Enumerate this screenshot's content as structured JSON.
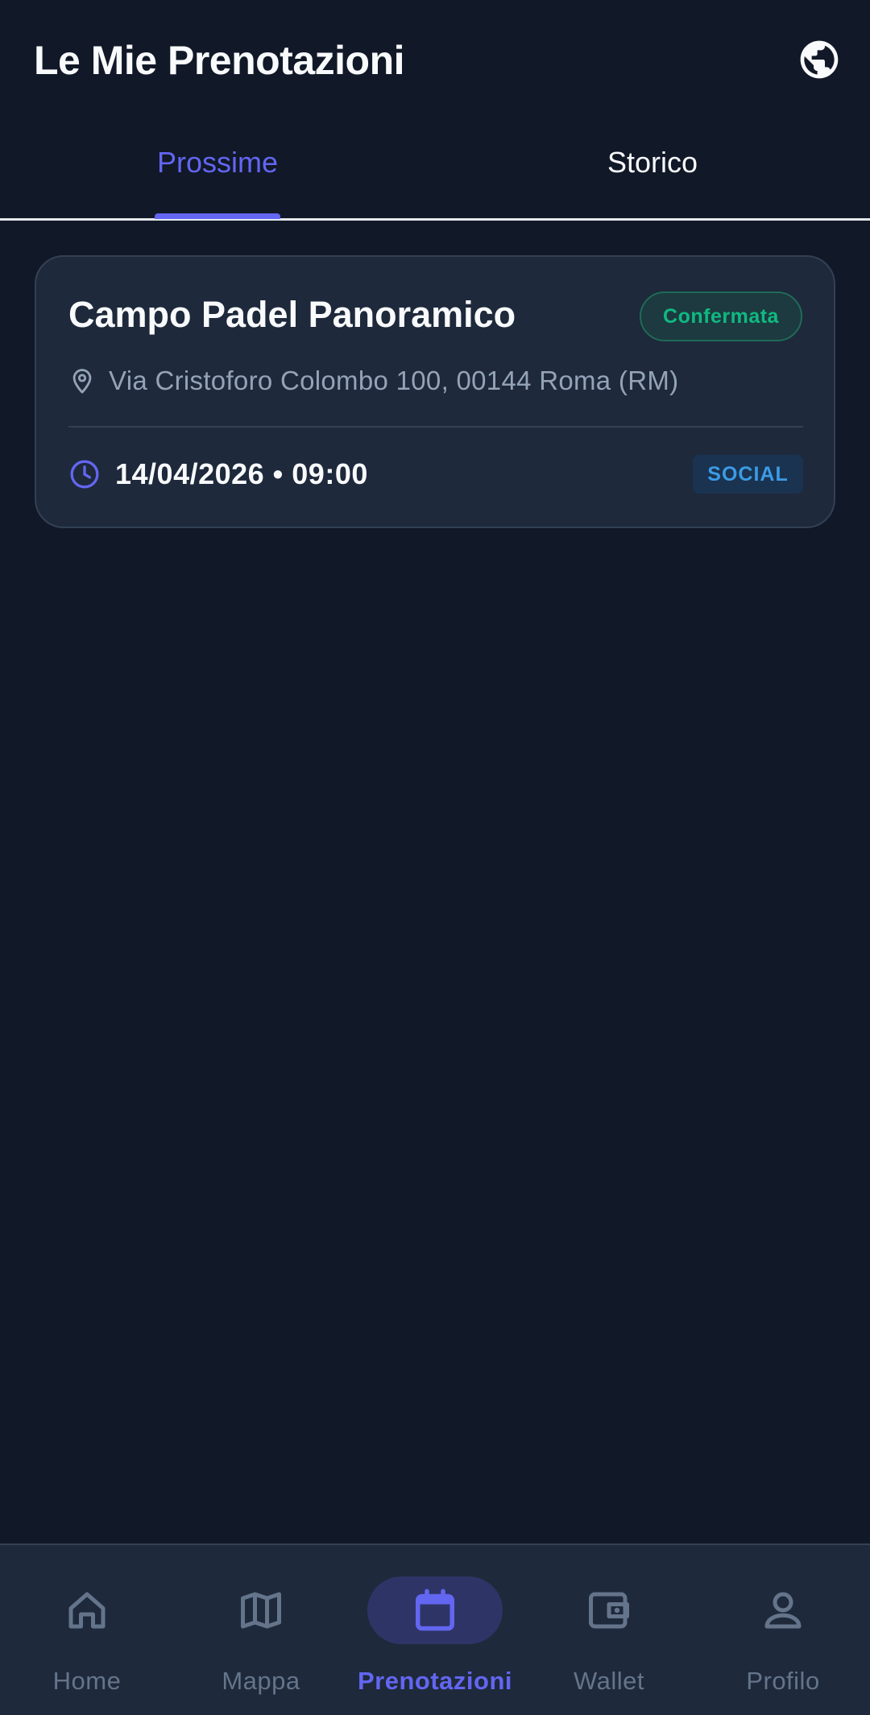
{
  "header": {
    "title": "Le Mie Prenotazioni",
    "language_icon": "globe-icon"
  },
  "tabs": [
    {
      "label": "Prossime",
      "active": true
    },
    {
      "label": "Storico",
      "active": false
    }
  ],
  "bookings": [
    {
      "name": "Campo Padel Panoramico",
      "status": "Confermata",
      "address": "Via Cristoforo Colombo 100, 00144 Roma (RM)",
      "datetime": "14/04/2026 • 09:00",
      "type": "SOCIAL",
      "icons": {
        "address": "location-pin-icon",
        "time": "clock-icon"
      }
    }
  ],
  "bottom_nav": {
    "items": [
      {
        "label": "Home",
        "icon": "home-icon",
        "active": false
      },
      {
        "label": "Mappa",
        "icon": "map-icon",
        "active": false
      },
      {
        "label": "Prenotazioni",
        "icon": "calendar-icon",
        "active": true
      },
      {
        "label": "Wallet",
        "icon": "wallet-icon",
        "active": false
      },
      {
        "label": "Profilo",
        "icon": "person-icon",
        "active": false
      }
    ]
  },
  "colors": {
    "background": "#111827",
    "surface": "#1e293b",
    "accent": "#6366f1",
    "success": "#10b981",
    "info": "#3b9be6",
    "muted": "#94a3b8"
  }
}
